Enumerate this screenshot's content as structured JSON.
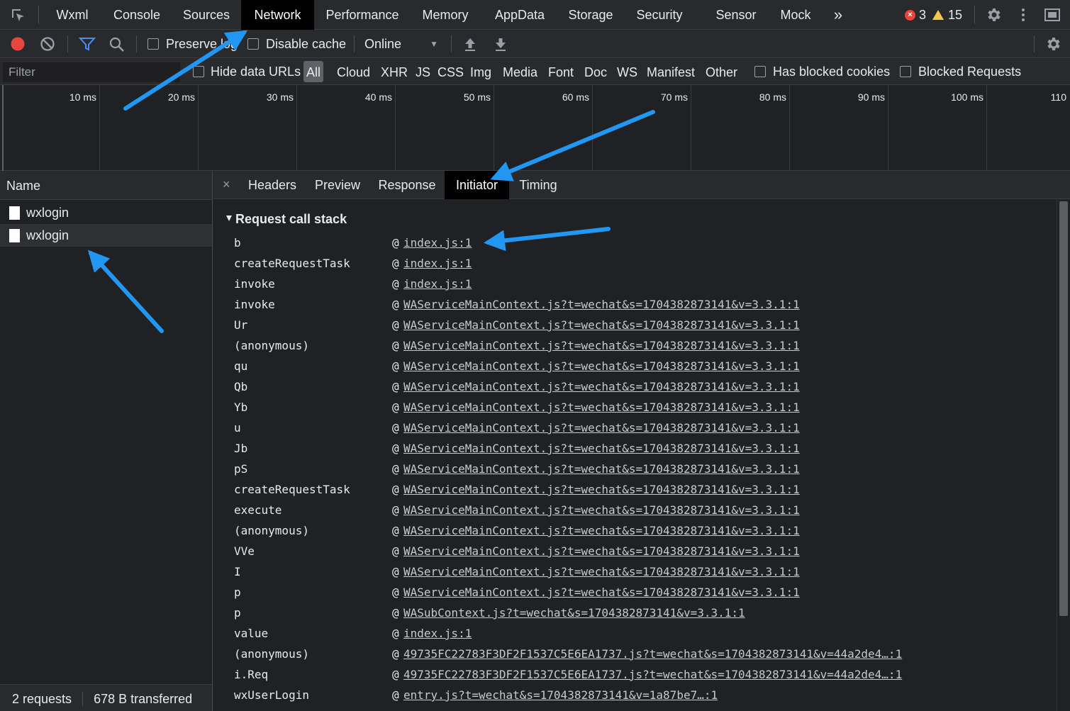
{
  "topbar": {
    "tabs": [
      "Wxml",
      "Console",
      "Sources",
      "Network",
      "Performance",
      "Memory",
      "AppData",
      "Storage",
      "Security",
      "Sensor",
      "Mock"
    ],
    "active_tab": "Network",
    "more_glyph": "»",
    "error_count": "3",
    "warning_count": "15",
    "error_glyph": "×"
  },
  "toolbar": {
    "preserve_log": "Preserve log",
    "disable_cache": "Disable cache",
    "throttle": "Online",
    "throttle_caret": "▼"
  },
  "filter": {
    "placeholder": "Filter",
    "hide_data_urls": "Hide data URLs",
    "types": [
      "All",
      "Cloud",
      "XHR",
      "JS",
      "CSS",
      "Img",
      "Media",
      "Font",
      "Doc",
      "WS",
      "Manifest",
      "Other"
    ],
    "has_blocked_cookies": "Has blocked cookies",
    "blocked_requests": "Blocked Requests"
  },
  "overview": {
    "ticks": [
      "10 ms",
      "20 ms",
      "30 ms",
      "40 ms",
      "50 ms",
      "60 ms",
      "70 ms",
      "80 ms",
      "90 ms",
      "100 ms",
      "110"
    ]
  },
  "requests": {
    "header": "Name",
    "items": [
      "wxlogin",
      "wxlogin"
    ],
    "footer_count": "2 requests",
    "footer_transferred": "678 B transferred"
  },
  "details": {
    "close_glyph": "×",
    "tabs": [
      "Headers",
      "Preview",
      "Response",
      "Initiator",
      "Timing"
    ],
    "active_tab": "Initiator",
    "section_title": "Request call stack",
    "at_symbol": "@",
    "frames": [
      {
        "fn": "b",
        "loc": "index.js:1"
      },
      {
        "fn": "createRequestTask",
        "loc": "index.js:1"
      },
      {
        "fn": "invoke",
        "loc": "index.js:1"
      },
      {
        "fn": "invoke",
        "loc": "WAServiceMainContext.js?t=wechat&s=1704382873141&v=3.3.1:1"
      },
      {
        "fn": "Ur",
        "loc": "WAServiceMainContext.js?t=wechat&s=1704382873141&v=3.3.1:1"
      },
      {
        "fn": "(anonymous)",
        "loc": "WAServiceMainContext.js?t=wechat&s=1704382873141&v=3.3.1:1"
      },
      {
        "fn": "qu",
        "loc": "WAServiceMainContext.js?t=wechat&s=1704382873141&v=3.3.1:1"
      },
      {
        "fn": "Qb",
        "loc": "WAServiceMainContext.js?t=wechat&s=1704382873141&v=3.3.1:1"
      },
      {
        "fn": "Yb",
        "loc": "WAServiceMainContext.js?t=wechat&s=1704382873141&v=3.3.1:1"
      },
      {
        "fn": "u",
        "loc": "WAServiceMainContext.js?t=wechat&s=1704382873141&v=3.3.1:1"
      },
      {
        "fn": "Jb",
        "loc": "WAServiceMainContext.js?t=wechat&s=1704382873141&v=3.3.1:1"
      },
      {
        "fn": "pS",
        "loc": "WAServiceMainContext.js?t=wechat&s=1704382873141&v=3.3.1:1"
      },
      {
        "fn": "createRequestTask",
        "loc": "WAServiceMainContext.js?t=wechat&s=1704382873141&v=3.3.1:1"
      },
      {
        "fn": "execute",
        "loc": "WAServiceMainContext.js?t=wechat&s=1704382873141&v=3.3.1:1"
      },
      {
        "fn": "(anonymous)",
        "loc": "WAServiceMainContext.js?t=wechat&s=1704382873141&v=3.3.1:1"
      },
      {
        "fn": "VVe",
        "loc": "WAServiceMainContext.js?t=wechat&s=1704382873141&v=3.3.1:1"
      },
      {
        "fn": "I",
        "loc": "WAServiceMainContext.js?t=wechat&s=1704382873141&v=3.3.1:1"
      },
      {
        "fn": "p",
        "loc": "WAServiceMainContext.js?t=wechat&s=1704382873141&v=3.3.1:1"
      },
      {
        "fn": "p",
        "loc": "WASubContext.js?t=wechat&s=1704382873141&v=3.3.1:1"
      },
      {
        "fn": "value",
        "loc": "index.js:1"
      },
      {
        "fn": "(anonymous)",
        "loc": "49735FC22783F3DF2F1537C5E6EA1737.js?t=wechat&s=1704382873141&v=44a2de4…:1"
      },
      {
        "fn": "i.Req",
        "loc": "49735FC22783F3DF2F1537C5E6EA1737.js?t=wechat&s=1704382873141&v=44a2de4…:1"
      },
      {
        "fn": "wxUserLogin",
        "loc": "entry.js?t=wechat&s=1704382873141&v=1a87be7…:1"
      }
    ]
  },
  "colors": {
    "annotation_arrow": "#2196f3",
    "record_red": "#e8453c",
    "filter_blue": "#4b8ef7"
  }
}
